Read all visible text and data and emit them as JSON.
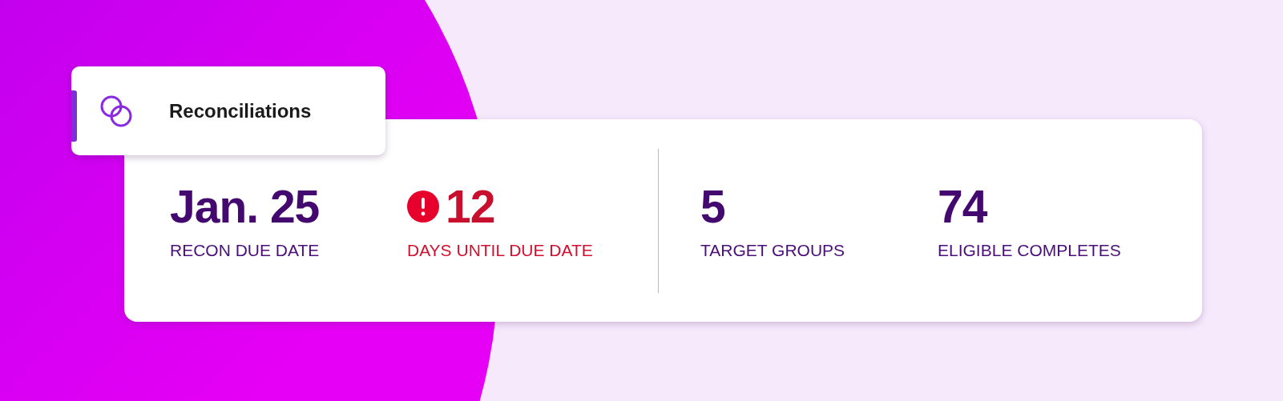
{
  "tag": {
    "title": "Reconciliations"
  },
  "stat_groups": [
    {
      "stats": [
        {
          "value": "Jan. 25",
          "label": "RECON DUE DATE",
          "alert": false
        },
        {
          "value": "12",
          "label": "DAYS UNTIL DUE DATE",
          "alert": true
        }
      ]
    },
    {
      "stats": [
        {
          "value": "5",
          "label": "TARGET GROUPS",
          "alert": false
        },
        {
          "value": "74",
          "label": "ELIGIBLE COMPLETES",
          "alert": false
        }
      ]
    }
  ]
}
